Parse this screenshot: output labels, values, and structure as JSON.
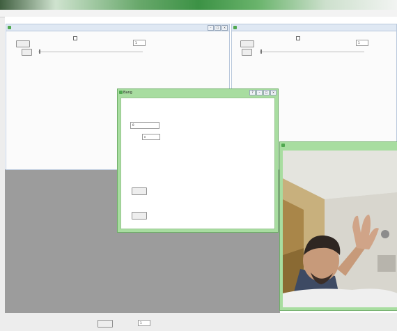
{
  "top_window": {
    "title": "",
    "menu": ""
  },
  "panels": [
    {
      "title": "",
      "buttons": {
        "start": "",
        "stop": ""
      },
      "label_left": "",
      "checkbox_label": "",
      "spin_value": "1",
      "status_text": ""
    },
    {
      "title": "",
      "buttons": {
        "start": "",
        "stop": ""
      },
      "label_left": "",
      "checkbox_label": "",
      "spin_value": "1",
      "status_text": ""
    }
  ],
  "dialog": {
    "title": "Bang",
    "field_label": "",
    "field_value": "0",
    "dropdown_label": "",
    "dropdown_value": "",
    "mid_button": "",
    "bottom_button": ""
  },
  "camera_window": {
    "title": ""
  },
  "bottom_bar": {
    "button": "",
    "label": "",
    "spin_value": "1"
  }
}
